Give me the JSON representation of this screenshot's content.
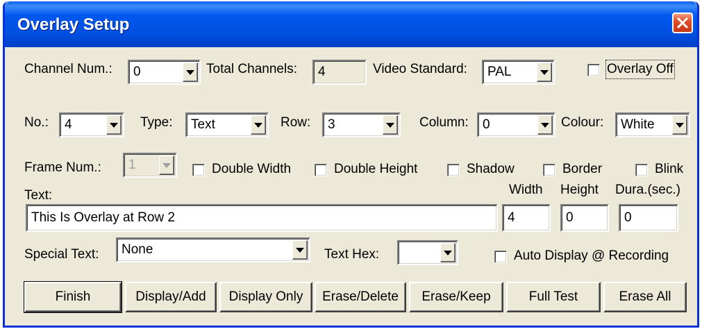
{
  "window": {
    "title": "Overlay Setup"
  },
  "row1": {
    "channel_num_label": "Channel Num.:",
    "channel_num_value": "0",
    "total_channels_label": "Total Channels:",
    "total_channels_value": "4",
    "video_standard_label": "Video Standard:",
    "video_standard_value": "PAL",
    "overlay_off_label": "Overlay Off"
  },
  "row2": {
    "no_label": "No.:",
    "no_value": "4",
    "type_label": "Type:",
    "type_value": "Text",
    "row_label": "Row:",
    "row_value": "3",
    "column_label": "Column:",
    "column_value": "0",
    "colour_label": "Colour:",
    "colour_value": "White"
  },
  "row3": {
    "frame_num_label": "Frame Num.:",
    "frame_num_value": "1",
    "double_width_label": "Double Width",
    "double_height_label": "Double Height",
    "shadow_label": "Shadow",
    "border_label": "Border",
    "blink_label": "Blink"
  },
  "text_section": {
    "text_label": "Text:",
    "text_value": "This Is Overlay at Row 2",
    "width_label": "Width",
    "width_value": "4",
    "height_label": "Height",
    "height_value": "0",
    "duration_label": "Dura.(sec.)",
    "duration_value": "0"
  },
  "row5": {
    "special_text_label": "Special Text:",
    "special_text_value": "None",
    "text_hex_label": "Text Hex:",
    "text_hex_value": "",
    "auto_display_label": "Auto Display @ Recording"
  },
  "buttons": {
    "finish": "Finish",
    "display_add": "Display/Add",
    "display_only": "Display Only",
    "erase_delete": "Erase/Delete",
    "erase_keep": "Erase/Keep",
    "full_test": "Full Test",
    "erase_all": "Erase All"
  }
}
